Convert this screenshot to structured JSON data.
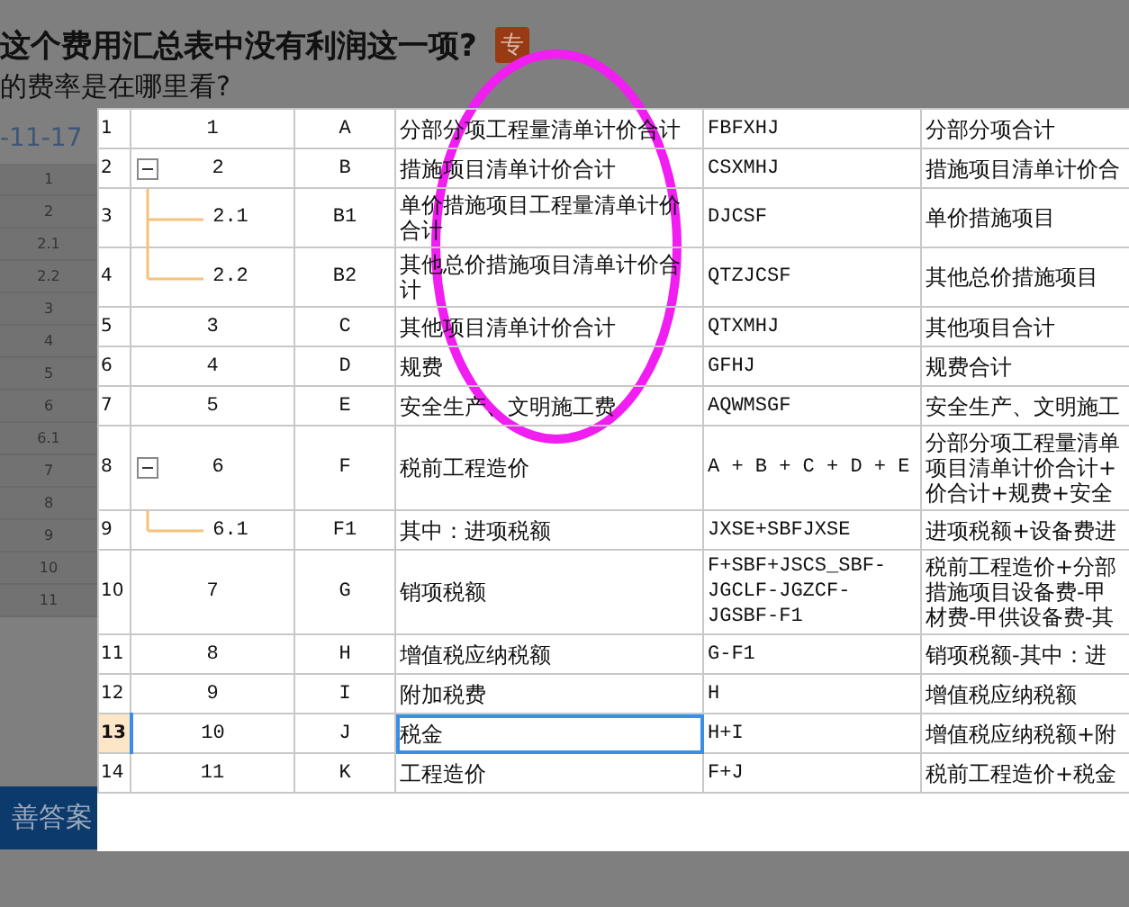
{
  "question": {
    "title": "这个费用汇总表中没有利润这一项?",
    "badge": "专",
    "subtitle": "的费率是在哪里看?",
    "date": "-11-17",
    "side_rows": [
      "1",
      "2",
      "2.1",
      "2.2",
      "3",
      "4",
      "5",
      "6",
      "6.1",
      "7",
      "8",
      "9",
      "10",
      "11"
    ],
    "answer_button": "善答案"
  },
  "table": {
    "rows": [
      {
        "line": "1",
        "index": "1",
        "code": "A",
        "name": "分部分项工程量清单计价合计",
        "formula": "FBFXHJ",
        "description": [
          "分部分项合计"
        ],
        "selected": false
      },
      {
        "line": "2",
        "index": "2",
        "code": "B",
        "name": "措施项目清单计价合计",
        "formula": "CSXMHJ",
        "description": [
          "措施项目清单计价合"
        ],
        "selected": false,
        "expanded": true,
        "children": [
          {
            "line": "3",
            "index": "2.1",
            "code": "B1",
            "name": "单价措施项目工程量清单计价合计",
            "formula": "DJCSF",
            "description": [
              "单价措施项目"
            ],
            "selected": false
          },
          {
            "line": "4",
            "index": "2.2",
            "code": "B2",
            "name": "其他总价措施项目清单计价合计",
            "formula": "QTZJCSF",
            "description": [
              "其他总价措施项目"
            ],
            "selected": false
          }
        ]
      },
      {
        "line": "5",
        "index": "3",
        "code": "C",
        "name": "其他项目清单计价合计",
        "formula": "QTXMHJ",
        "description": [
          "其他项目合计"
        ],
        "selected": false
      },
      {
        "line": "6",
        "index": "4",
        "code": "D",
        "name": "规费",
        "formula": "GFHJ",
        "description": [
          "规费合计"
        ],
        "selected": false
      },
      {
        "line": "7",
        "index": "5",
        "code": "E",
        "name": "安全生产、文明施工费",
        "formula": "AQWMSGF",
        "description": [
          "安全生产、文明施工"
        ],
        "selected": false
      },
      {
        "line": "8",
        "index": "6",
        "code": "F",
        "name": "税前工程造价",
        "formula": "A + B + C + D + E",
        "description": [
          "分部分项工程量清单",
          "项目清单计价合计+",
          "价合计+规费+安全"
        ],
        "selected": false,
        "expanded": true,
        "children": [
          {
            "line": "9",
            "index": "6.1",
            "code": "F1",
            "name": "其中：进项税额",
            "formula": "JXSE+SBFJXSE",
            "description": [
              "进项税额+设备费进"
            ],
            "selected": false
          }
        ]
      },
      {
        "line": "10",
        "index": "7",
        "code": "G",
        "name": "销项税额",
        "formula": "F+SBF+JSCS_SBF-JGCLF-JGZCF-JGSBF-F1",
        "description": [
          "税前工程造价+分部",
          "措施项目设备费-甲",
          "材费-甲供设备费-其"
        ],
        "selected": false
      },
      {
        "line": "11",
        "index": "8",
        "code": "H",
        "name": "增值税应纳税额",
        "formula": "G-F1",
        "description": [
          "销项税额-其中：进"
        ],
        "selected": false
      },
      {
        "line": "12",
        "index": "9",
        "code": "I",
        "name": "附加税费",
        "formula": "H",
        "description": [
          "增值税应纳税额"
        ],
        "selected": false
      },
      {
        "line": "13",
        "index": "10",
        "code": "J",
        "name": "税金",
        "formula": "H+I",
        "description": [
          "增值税应纳税额+附"
        ],
        "selected": true
      },
      {
        "line": "14",
        "index": "11",
        "code": "K",
        "name": "工程造价",
        "formula": "F+J",
        "description": [
          "税前工程造价+税金"
        ],
        "selected": false
      }
    ]
  }
}
